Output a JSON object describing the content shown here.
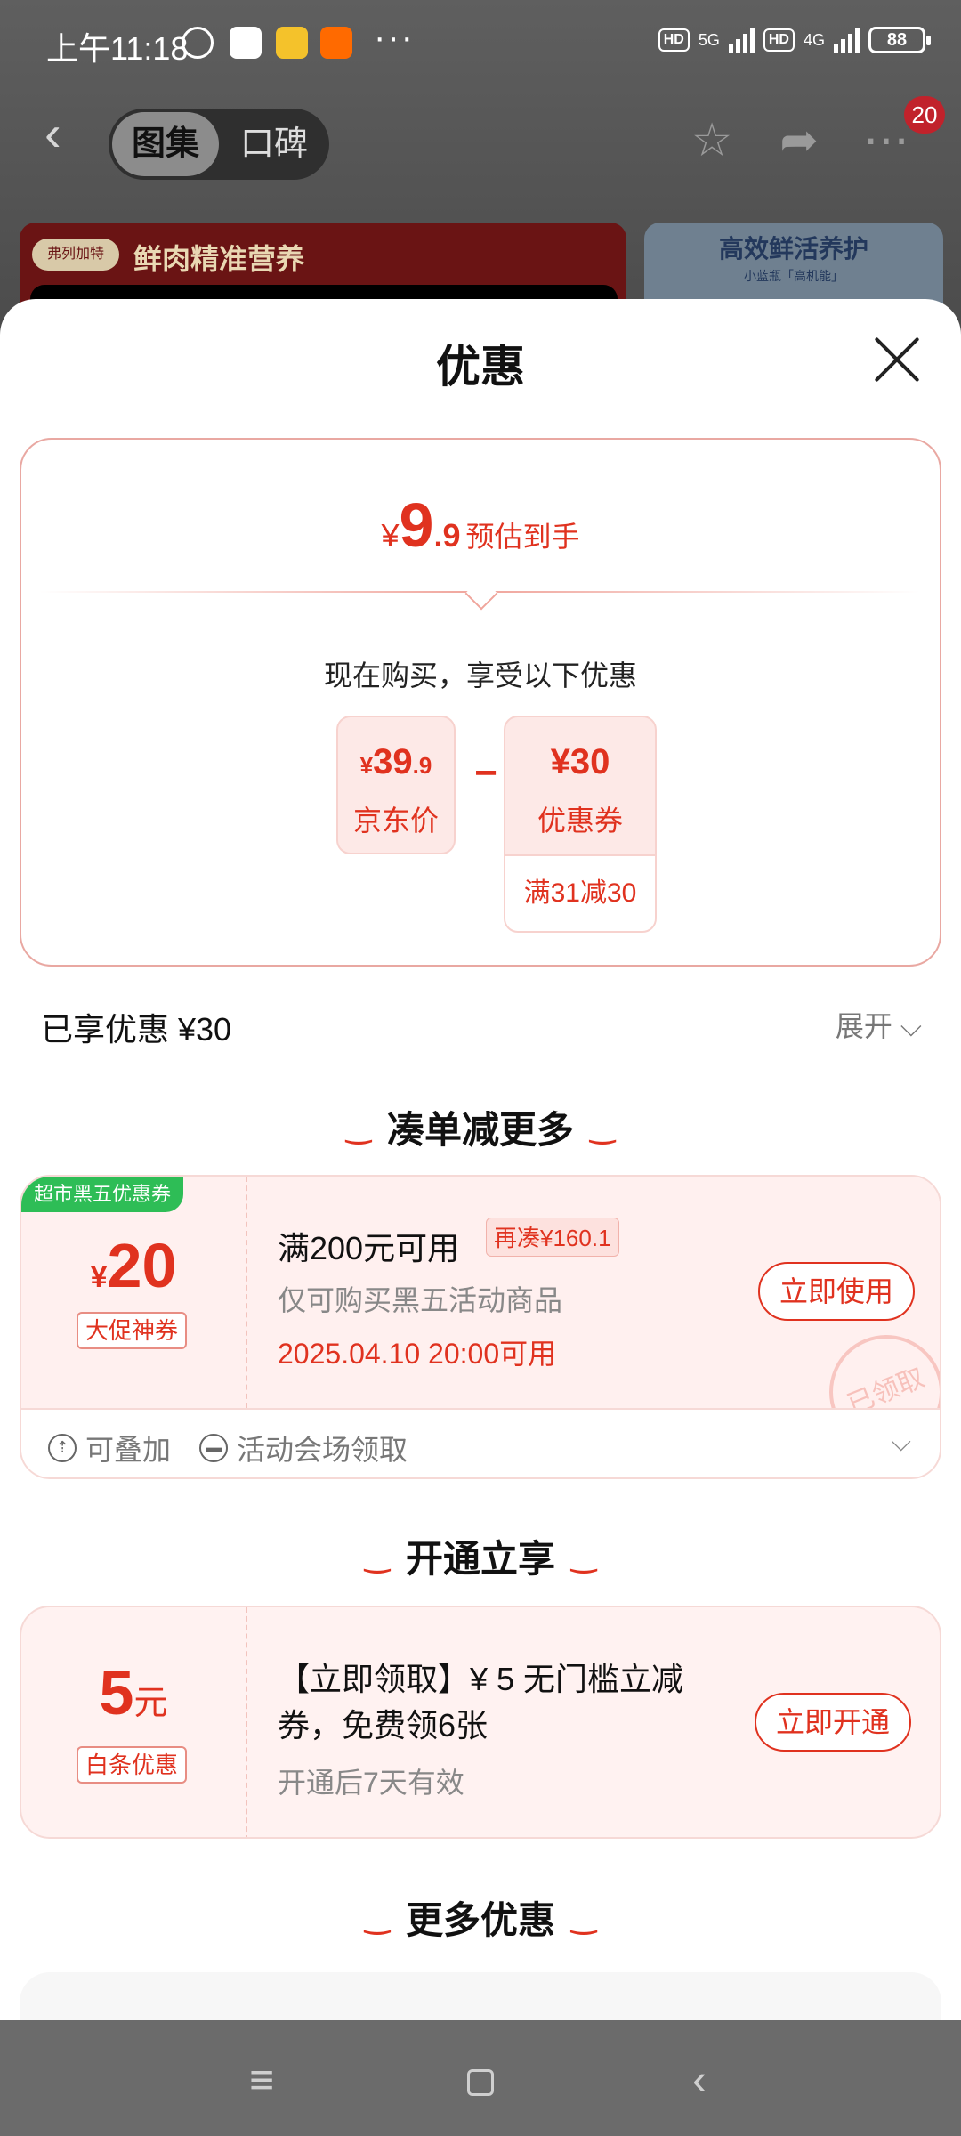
{
  "status_bar": {
    "time": "上午11:18",
    "dots": "···",
    "hd1": "HD",
    "net1": "5G",
    "hd2": "HD",
    "net2": "4G",
    "battery": "88"
  },
  "top_nav": {
    "tab_active": "图集",
    "tab_inactive": "口碑",
    "cart_badge": "20"
  },
  "background_banners": {
    "left_tag": "弗列加特",
    "left_text": "鲜肉精准营养",
    "right_title": "高效鲜活养护",
    "right_sub": "小蓝瓶「高机能」"
  },
  "sheet": {
    "title": "优惠",
    "estimate": {
      "currency": "¥",
      "integer": "9",
      "decimal": ".9",
      "label": "预估到手"
    },
    "now_text": "现在购买，享受以下优惠",
    "jd_price": {
      "currency": "¥",
      "integer": "39",
      "decimal": ".9",
      "label": "京东价"
    },
    "minus": "−",
    "coupon_box": {
      "value": "¥30",
      "label": "优惠券",
      "rule": "满31减30"
    },
    "enjoyed": "已享优惠 ¥30",
    "expand": "展开 ⌵"
  },
  "section1": {
    "title": "凑单减更多",
    "coupon": {
      "ribbon": "超市黑五优惠券",
      "currency": "¥",
      "amount": "20",
      "type_tag": "大促神券",
      "title": "满200元可用",
      "recoup": "再凑¥160.1",
      "desc": "仅可购买黑五活动商品",
      "time": "2025.04.10 20:00可用",
      "button": "立即使用",
      "stamp": "已领取",
      "meta1": "可叠加",
      "meta2": "活动会场领取"
    }
  },
  "section2": {
    "title": "开通立享",
    "coupon": {
      "amount": "5",
      "unit": "元",
      "type_tag": "白条优惠",
      "title_line1": "【立即领取】¥ 5 无门槛立减",
      "title_line2": "券，免费领6张",
      "desc": "开通后7天有效",
      "button": "立即开通"
    }
  },
  "section3": {
    "title": "更多优惠"
  },
  "colors": {
    "accent_red": "#e0321f",
    "ribbon_green": "#2ebd56",
    "coupon_bg": "#fff0ef"
  }
}
